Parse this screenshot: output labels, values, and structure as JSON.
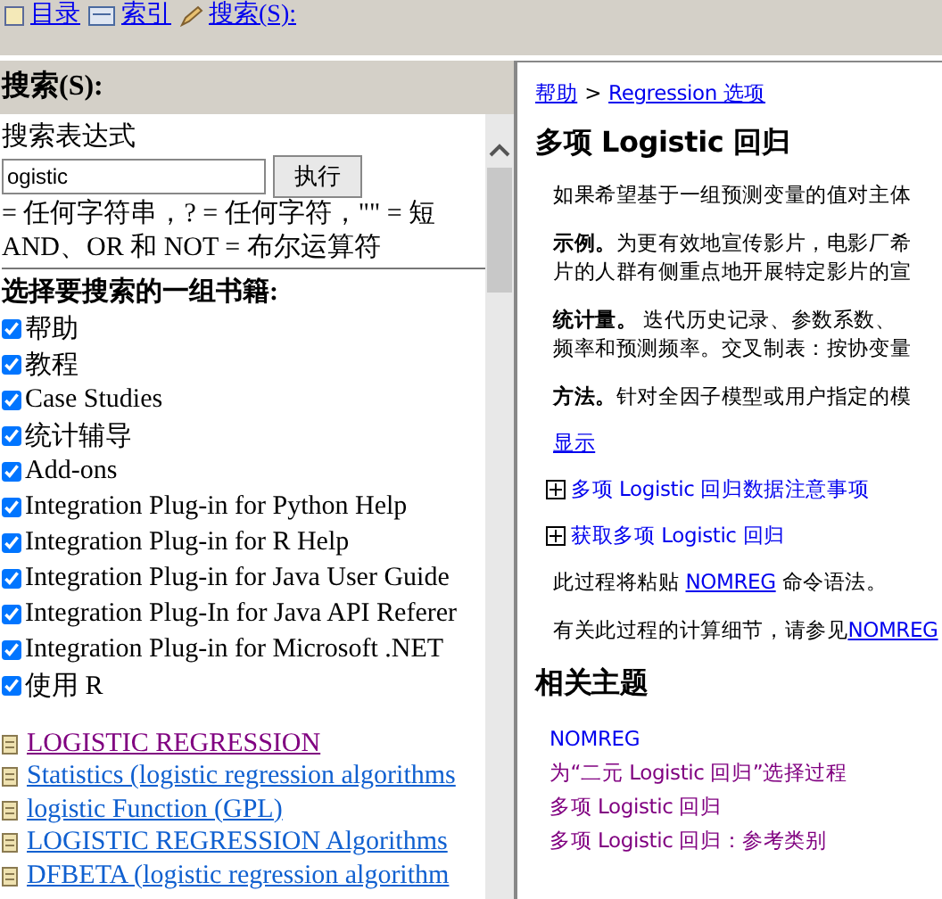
{
  "nav_links": [
    {
      "label": "目录"
    },
    {
      "label": "索引"
    },
    {
      "label": "搜索(S):"
    }
  ],
  "search_panel": {
    "header": "搜索(S):",
    "expression_label": "搜索表达式",
    "query": "ogistic",
    "run_button": "执行",
    "hints": [
      "= 任何字符串，? = 任何字符，\"\" = 短",
      "AND、OR 和 NOT = 布尔运算符"
    ],
    "books_label": "选择要搜索的一组书籍:",
    "books": [
      {
        "label": "帮助",
        "checked": true
      },
      {
        "label": "教程",
        "checked": true
      },
      {
        "label": "Case Studies",
        "checked": true
      },
      {
        "label": "统计辅导",
        "checked": true
      },
      {
        "label": "Add-ons",
        "checked": true
      },
      {
        "label": "Integration Plug-in for Python Help",
        "checked": true
      },
      {
        "label": "Integration Plug-in for R Help",
        "checked": true
      },
      {
        "label": "Integration Plug-in for Java User Guide",
        "checked": true
      },
      {
        "label": "Integration Plug-In for Java API Referer",
        "checked": true
      },
      {
        "label": "Integration Plug-in for Microsoft .NET",
        "checked": true
      },
      {
        "label": "使用 R",
        "checked": true
      }
    ],
    "results": [
      {
        "title": "LOGISTIC REGRESSION",
        "visited": true
      },
      {
        "title": "Statistics (logistic regression algorithms",
        "visited": false
      },
      {
        "title": "logistic Function (GPL)",
        "visited": false
      },
      {
        "title": "LOGISTIC REGRESSION Algorithms",
        "visited": false
      },
      {
        "title": "DFBETA (logistic regression algorithm",
        "visited": false
      }
    ]
  },
  "topic": {
    "breadcrumb": [
      {
        "label": "帮助"
      },
      {
        "label": "Regression 选项"
      }
    ],
    "breadcrumb_separator": ">",
    "title": "多项 Logistic 回归",
    "paragraphs": [
      [
        "如果希望基于一组预测变量的值对主体"
      ],
      [
        "**示例。**为更有效地宣传影片，电影厂希",
        "片的人群有侧重点地开展特定影片的宣"
      ],
      [
        "**统计量。** 迭代历史记录、参数系数、",
        "频率和预测频率。交叉制表：按协变量"
      ],
      [
        "**方法。**针对全因子模型或用户指定的模"
      ]
    ],
    "show_link": "显示",
    "expanders": [
      {
        "label": "多项 Logistic 回归数据注意事项",
        "expanded": false
      },
      {
        "label": "获取多项 Logistic 回归",
        "expanded": false
      }
    ],
    "paste_note": {
      "before": "此过程将粘贴 ",
      "link": "NOMREG",
      "after": " 命令语法。"
    },
    "details_note": {
      "before": "有关此过程的计算细节，请参见",
      "link": "NOMREG"
    },
    "related_heading": "相关主题",
    "related": [
      {
        "label": "NOMREG",
        "visited": false
      },
      {
        "label": "为“二元 Logistic 回归”选择过程",
        "visited": true
      },
      {
        "label": "多项 Logistic 回归",
        "visited": true
      },
      {
        "label": "多项 Logistic 回归：参考类别",
        "visited": true
      }
    ]
  }
}
